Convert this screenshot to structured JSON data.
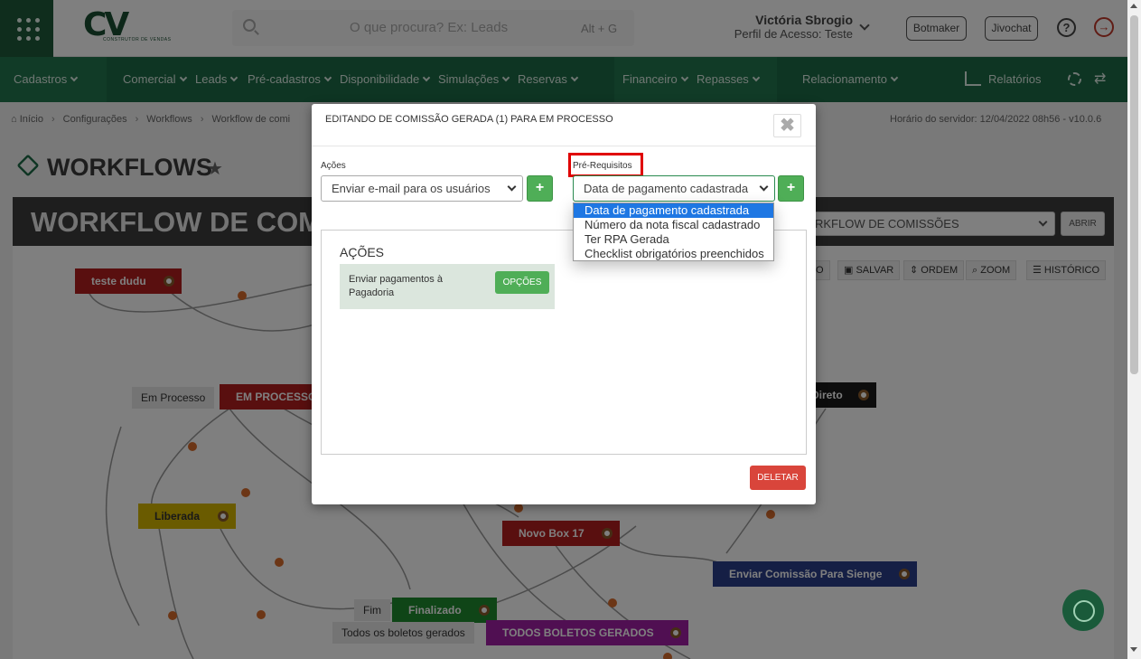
{
  "topbar": {
    "logo_text": "CV",
    "logo_sub": "CONSTRUTOR DE VENDAS",
    "search_placeholder": "O que procura? Ex: Leads",
    "search_shortcut": "Alt + G",
    "user_name": "Victória Sbrogio",
    "user_profile": "Perfil de Acesso: Teste",
    "botmaker_label": "Botmaker",
    "jivochat_label": "Jivochat",
    "help_glyph": "?",
    "logout_glyph": "→"
  },
  "nav": {
    "items": [
      "Cadastros",
      "Comercial",
      "Leads",
      "Pré-cadastros",
      "Disponibilidade",
      "Simulações",
      "Reservas",
      "Financeiro",
      "Repasses",
      "Relacionamento"
    ],
    "reports_label": "Relatórios",
    "swap_glyph": "⇄"
  },
  "breadcrumb": {
    "items": [
      "Início",
      "Configurações",
      "Workflows",
      "Workflow de comi"
    ],
    "server_time": "Horário do servidor: 12/04/2022 08h56 - v10.0.6"
  },
  "page": {
    "title": "WORKFLOWS",
    "star_glyph": "★"
  },
  "workflow": {
    "title": "WORKFLOW DE COMI",
    "select_value": "RKFLOW DE COMISSÕES",
    "open_label": "ABRIR",
    "toolbar": {
      "prev_label": "O",
      "save_label": "SALVAR",
      "order_label": "ORDEM",
      "zoom_label": "ZOOM",
      "history_label": "HISTÓRICO"
    },
    "nodes": {
      "teste_dudu": "teste dudu",
      "em_processo_label": "Em Processo",
      "em_processo": "EM PROCESSO",
      "direto": "Direto",
      "liberada": "Liberada",
      "novo_box": "Novo Box 17",
      "enviar_sienge": "Enviar Comissão Para Sienge",
      "fim_label": "Fim",
      "finalizado": "Finalizado",
      "boletos_label": "Todos os boletos gerados",
      "boletos": "TODOS BOLETOS GERADOS"
    }
  },
  "modal": {
    "title": "EDITANDO DE COMISSÃO GERADA (1) PARA EM PROCESSO",
    "close_glyph": "✖",
    "actions_label": "Ações",
    "actions_select": "Enviar e-mail para os usuários",
    "prereq_label": "Pré-Requisitos",
    "prereq_select": "Data de pagamento cadastrada",
    "add_glyph": "+",
    "actions_box_title": "AÇÕES",
    "action_card_text": "Enviar pagamentos à Pagadoria",
    "options_label": "OPÇÕES",
    "delete_label": "DELETAR"
  },
  "dropdown": {
    "options": [
      "Data de pagamento cadastrada",
      "Número da nota fiscal cadastrado",
      "Ter RPA Gerada",
      "Checklist obrigatórios preenchidos"
    ],
    "selected_index": 0
  }
}
